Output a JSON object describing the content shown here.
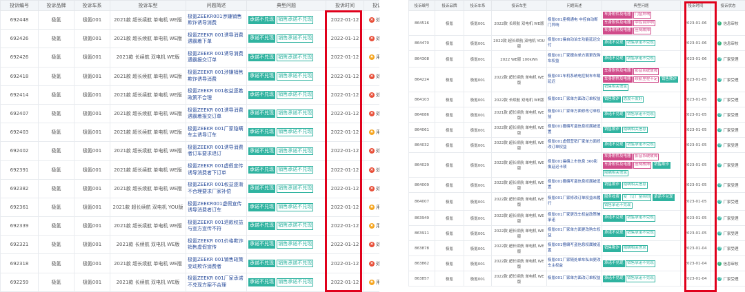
{
  "left": {
    "headers": [
      "投诉编号",
      "投诉品牌",
      "投诉车系",
      "投诉车型",
      "问题简述",
      "典型问题",
      "投诉时间",
      "投诉状态"
    ],
    "rows": [
      {
        "id": "692448",
        "brand": "极氪",
        "series": "极氪001",
        "model": "2021款 超长续航 单电机 WE版",
        "desc": "极氪ZEEKR001涉嫌销售欺诈诱导消费",
        "tags": [
          {
            "t": "承诺不兑现",
            "s": "solid"
          },
          {
            "t": "销售承诺不兑现",
            "s": "outline"
          }
        ],
        "date": "2022-01-12",
        "status": "处理投诉",
        "icon": "red"
      },
      {
        "id": "692426",
        "brand": "极氪",
        "series": "极氪001",
        "model": "2021款 超长续航 单电机 WE版",
        "desc": "极氪ZEEKR 001诱导消费遇霸着下单",
        "tags": [
          {
            "t": "承诺不兑现",
            "s": "solid"
          },
          {
            "t": "销售承诺不兑现",
            "s": "outline"
          }
        ],
        "date": "2022-01-12",
        "status": "处理投诉",
        "icon": "red"
      },
      {
        "id": "692426",
        "brand": "极氪",
        "series": "极氪001",
        "model": "2021款 长续航 双电机 WE版",
        "desc": "极氪ZEEKR 001诱导消费遇霸报交订单",
        "tags": [
          {
            "t": "承诺不兑现",
            "s": "solid"
          },
          {
            "t": "销售承诺不兑现",
            "s": "outline"
          }
        ],
        "date": "2022-01-12",
        "status": "用户评分",
        "icon": "orange"
      },
      {
        "id": "692418",
        "brand": "极氪",
        "series": "极氪001",
        "model": "2021款 超长续航 单电机 WE版",
        "desc": "极氪ZEEKR 001涉嫌销售欺诈诱导消费",
        "tags": [
          {
            "t": "承诺不兑现",
            "s": "solid"
          },
          {
            "t": "销售承诺不兑现",
            "s": "outline"
          }
        ],
        "date": "2022-01-12",
        "status": "处理投诉",
        "icon": "red"
      },
      {
        "id": "692414",
        "brand": "极氪",
        "series": "极氪001",
        "model": "2021款 超长续航 单电机 WE版",
        "desc": "极氪ZEEKR 001权益逐着政策不合理",
        "tags": [
          {
            "t": "承诺不兑现",
            "s": "solid"
          },
          {
            "t": "销售承诺不兑现",
            "s": "outline"
          }
        ],
        "date": "2022-01-12",
        "status": "处理投诉",
        "icon": "red"
      },
      {
        "id": "692407",
        "brand": "极氪",
        "series": "极氪001",
        "model": "2021款 超长续航 单电机 WE版",
        "desc": "极氪ZEEKR 001诱导消费遇霸着报交订单",
        "tags": [
          {
            "t": "承诺不兑现",
            "s": "solid"
          },
          {
            "t": "销售承诺不兑现",
            "s": "outline"
          }
        ],
        "date": "2022-01-12",
        "status": "处理投诉",
        "icon": "red"
      },
      {
        "id": "692403",
        "brand": "极氪",
        "series": "极氪001",
        "model": "2021款 超长续航 单电机 WE版",
        "desc": "极氪ZEEKR 001厂家隐瞒车主诱导订车",
        "tags": [
          {
            "t": "承诺不兑现",
            "s": "solid"
          },
          {
            "t": "销售承诺不兑现",
            "s": "outline"
          }
        ],
        "date": "2022-01-12",
        "status": "用户评分",
        "icon": "orange"
      },
      {
        "id": "692402",
        "brand": "极氪",
        "series": "极氪001",
        "model": "2021款 超长续航 单电机 WE版",
        "desc": "极氪ZEEKR 001诱导消费者订车要求退订",
        "tags": [
          {
            "t": "承诺不兑现",
            "s": "solid"
          },
          {
            "t": "销售承诺不兑现",
            "s": "outline"
          }
        ],
        "date": "2022-01-12",
        "status": "处理投诉",
        "icon": "red"
      },
      {
        "id": "692391",
        "brand": "极氪",
        "series": "极氪001",
        "model": "2021款 超长续航 单电机 WE版",
        "desc": "极氪ZEEKR 001虚假宣传诱导消费者下订单",
        "tags": [
          {
            "t": "承诺不兑现",
            "s": "solid"
          },
          {
            "t": "销售承诺不兑现",
            "s": "outline"
          }
        ],
        "date": "2022-01-12",
        "status": "处理投诉",
        "icon": "red"
      },
      {
        "id": "692382",
        "brand": "极氪",
        "series": "极氪001",
        "model": "2021款 超长续航 单电机 WE版",
        "desc": "极氪ZEEKR 001权益逐渐不合理要求厂家补偿",
        "tags": [
          {
            "t": "承诺不兑现",
            "s": "solid"
          },
          {
            "t": "销售承诺不兑现",
            "s": "outline"
          }
        ],
        "date": "2022-01-12",
        "status": "处理投诉",
        "icon": "red"
      },
      {
        "id": "692361",
        "brand": "极氪",
        "series": "极氪001",
        "model": "2021款 超长续航 双电机 YOU版",
        "desc": "极氪ZEEKR001虚假宣传诱导消费者订车",
        "tags": [
          {
            "t": "承诺不兑现",
            "s": "solid"
          },
          {
            "t": "销售承诺不兑现",
            "s": "outline"
          }
        ],
        "date": "2022-01-12",
        "status": "用户评分",
        "icon": "orange"
      },
      {
        "id": "692339",
        "brand": "极氪",
        "series": "极氪001",
        "model": "2021款 超长续航 单电机 WE版",
        "desc": "极氪ZEEKR 001退款权益与宣方宣传不符",
        "tags": [
          {
            "t": "承诺不兑现",
            "s": "solid"
          },
          {
            "t": "销售承诺不兑现",
            "s": "outline"
          }
        ],
        "date": "2022-01-12",
        "status": "用户评分",
        "icon": "orange"
      },
      {
        "id": "692321",
        "brand": "极氪",
        "series": "极氪001",
        "model": "2021款 长续航 双电机 WE版",
        "desc": "极氪ZEEKR 001价格欺诈销售虚假宣传",
        "tags": [
          {
            "t": "承诺不兑现",
            "s": "solid"
          },
          {
            "t": "销售承诺不兑现",
            "s": "outline"
          }
        ],
        "date": "2022-01-12",
        "status": "处理投诉",
        "icon": "red"
      },
      {
        "id": "692318",
        "brand": "极氪",
        "series": "极氪001",
        "model": "2021款 超长续航 单电机 WE版",
        "desc": "极氪ZEEKR 001销售政策变动欺诈消费者",
        "tags": [
          {
            "t": "承诺不兑现",
            "s": "solid"
          },
          {
            "t": "销售承诺不兑现",
            "s": "outline"
          }
        ],
        "date": "2022-01-12",
        "status": "处理投诉",
        "icon": "red"
      },
      {
        "id": "692259",
        "brand": "极氪",
        "series": "极氪001",
        "model": "2021款 长续航 双电机 WE版",
        "desc": "极氪ZEEKR 001厂家承诺不兑现方案不合理",
        "tags": [
          {
            "t": "承诺不兑现",
            "s": "solid"
          },
          {
            "t": "销售承诺不兑现",
            "s": "outline"
          }
        ],
        "date": "2022-01-12",
        "status": "用户评分",
        "icon": "orange"
      }
    ]
  },
  "right": {
    "headers": [
      "投诉编号",
      "投诉品牌",
      "投诉车系",
      "投诉车型",
      "问题简述",
      "典型问题",
      "投诉时间",
      "投诉状态"
    ],
    "rows": [
      {
        "id": "864516",
        "brand": "极氪",
        "series": "极氪001",
        "model": "2022款 长续航 双电机 WE版",
        "desc": "极氪001座椅通电 中控自动断门异响",
        "tags": [
          {
            "t": "车身附件及电器",
            "s": "pinkfill"
          },
          {
            "t": "门窗异响",
            "s": "pink"
          },
          {
            "t": "车身附件及电器",
            "s": "pinkfill"
          },
          {
            "t": "中控台异响",
            "s": "pink"
          },
          {
            "t": "车身附件及电器",
            "s": "pinkfill"
          },
          {
            "t": "座椅故障",
            "s": "pink"
          }
        ],
        "date": "2023-01-06",
        "status": "信息审核",
        "icon": "green",
        "rh": 34
      },
      {
        "id": "864470",
        "brand": "极氪",
        "series": "极氪001",
        "model": "2022款 超长续航 双电机 YOU版",
        "desc": "极氪001操自动泊车功能延迟交付",
        "tags": [
          {
            "t": "承诺不兑现",
            "s": "solid"
          },
          {
            "t": "销售承诺不兑现",
            "s": "outline"
          }
        ],
        "date": "2023-01-06",
        "status": "信息审核",
        "icon": "green",
        "rh": 22
      },
      {
        "id": "864308",
        "brand": "极氪",
        "series": "极氪001",
        "model": "2022 WE版 100kWh",
        "desc": "极氪001厂家擅自单方面更改购车权益",
        "tags": [
          {
            "t": "承诺不兑现",
            "s": "solid"
          },
          {
            "t": "销售承诺不兑现",
            "s": "outline"
          }
        ],
        "date": "2023-01-06",
        "status": "厂家受理",
        "icon": "teal",
        "rh": 24
      },
      {
        "id": "864224",
        "brand": "极氪",
        "series": "极氪001",
        "model": "2022款 超长续航 单电机 WE版",
        "desc": "极氪001车机系统电控制车车载延迟",
        "tags": [
          {
            "t": "车身附件及电器",
            "s": "pinkfill"
          },
          {
            "t": "影音系统故障",
            "s": "pink"
          },
          {
            "t": "车身附件及电器",
            "s": "pinkfill"
          },
          {
            "t": "续航里程不足",
            "s": "pink"
          },
          {
            "t": "销售欺诈",
            "s": "solid"
          },
          {
            "t": "销售相关信息",
            "s": "outline"
          }
        ],
        "date": "2023-01-05",
        "status": "厂家受理",
        "icon": "teal",
        "rh": 36
      },
      {
        "id": "864103",
        "brand": "极氪",
        "series": "极氪001",
        "model": "2022款 长续航 双电机 WE版",
        "desc": "极氪001厂家单方面改订单权益",
        "tags": [
          {
            "t": "销售欺诈",
            "s": "solid"
          },
          {
            "t": "态度不友好",
            "s": "outline"
          }
        ],
        "date": "2023-01-05",
        "status": "厂家受理",
        "icon": "teal",
        "rh": 22
      },
      {
        "id": "864086",
        "brand": "极氪",
        "series": "极氪001",
        "model": "2021款 超长续航 单电机 WE版",
        "desc": "极氪001厂家单方面修改订单权益",
        "tags": [
          {
            "t": "承诺不兑现",
            "s": "solid"
          },
          {
            "t": "销售承诺不兑现",
            "s": "outline"
          }
        ],
        "date": "2023-01-05",
        "status": "厂家受理",
        "icon": "teal",
        "rh": 22
      },
      {
        "id": "864061",
        "brand": "极氪",
        "series": "极氪001",
        "model": "2022款 超长续航 单电机 WE版",
        "desc": "极氪001擅编写盗信息权属被迫置",
        "tags": [
          {
            "t": "销售欺诈",
            "s": "solid"
          },
          {
            "t": "隐瞒相关信息",
            "s": "outline"
          }
        ],
        "date": "2023-01-05",
        "status": "厂家受理",
        "icon": "teal",
        "rh": 22
      },
      {
        "id": "864032",
        "brand": "极氪",
        "series": "极氪001",
        "model": "2022款 超长续航 单电机 WE版",
        "desc": "极氪001虚假营销厂家单方面修改订单权益",
        "tags": [
          {
            "t": "承诺不兑现",
            "s": "solid"
          },
          {
            "t": "销售承诺不兑现",
            "s": "outline"
          }
        ],
        "date": "2023-01-05",
        "status": "厂家受理",
        "icon": "teal",
        "rh": 22
      },
      {
        "id": "864029",
        "brand": "极氪",
        "series": "极氪001",
        "model": "2022款 超长续航 单电机 WE版",
        "desc": "极氪001操编上市信息 360影像延迟卡顿",
        "tags": [
          {
            "t": "车身附件及电器",
            "s": "pinkfill"
          },
          {
            "t": "影音系统故障",
            "s": "pink"
          },
          {
            "t": "车身附件及电器",
            "s": "pinkfill"
          },
          {
            "t": "座椅故障",
            "s": "pink"
          },
          {
            "t": "销售欺诈",
            "s": "solid"
          },
          {
            "t": "隐瞒相关信息",
            "s": "outline"
          }
        ],
        "date": "2023-01-05",
        "status": "厂家受理",
        "icon": "teal",
        "rh": 36
      },
      {
        "id": "864009",
        "brand": "极氪",
        "series": "极氪001",
        "model": "2022款 超长续航 单电机 WE版",
        "desc": "极氪001擅编写盗信息权属被迫置",
        "tags": [
          {
            "t": "销售欺诈",
            "s": "solid"
          },
          {
            "t": "隐瞒相关信息",
            "s": "outline"
          }
        ],
        "date": "2023-01-05",
        "status": "厂家受理",
        "icon": "teal",
        "rh": 22
      },
      {
        "id": "864007",
        "brand": "极氪",
        "series": "极氪001",
        "model": "2022款 超长续航 单电机 WE版",
        "desc": "极氪001厂家修改订单权益未履行",
        "tags": [
          {
            "t": "服务收费",
            "s": "solid"
          },
          {
            "t": "变（订）金纠纷",
            "s": "outline"
          },
          {
            "t": "承诺不兑现",
            "s": "solid"
          },
          {
            "t": "销售承诺不兑现",
            "s": "outline"
          }
        ],
        "date": "2023-01-05",
        "status": "厂家受理",
        "icon": "teal",
        "rh": 26
      },
      {
        "id": "863949",
        "brand": "极氪",
        "series": "极氪001",
        "model": "2022款 超长续航 单电机 WE版",
        "desc": "极氪001厂家更改车权益政策兼承诺",
        "tags": [
          {
            "t": "承诺不兑现",
            "s": "solid"
          },
          {
            "t": "销售承诺不兑现",
            "s": "outline"
          }
        ],
        "date": "2023-01-05",
        "status": "厂家受理",
        "icon": "teal",
        "rh": 22
      },
      {
        "id": "863911",
        "brand": "极氪",
        "series": "极氪001",
        "model": "2022款 超长续航 单电机 WE版",
        "desc": "极氪001厂家单方面更改购车权益",
        "tags": [
          {
            "t": "承诺不兑现",
            "s": "solid"
          },
          {
            "t": "销售承诺不兑现",
            "s": "outline"
          }
        ],
        "date": "2023-01-05",
        "status": "厂家受理",
        "icon": "teal",
        "rh": 22
      },
      {
        "id": "863878",
        "brand": "极氪",
        "series": "极氪001",
        "model": "2022款 超长续航 单电机 WE版",
        "desc": "极氪001擅编写盗信息权属被迫置",
        "tags": [
          {
            "t": "销售欺诈",
            "s": "solid"
          },
          {
            "t": "隐瞒相关信息",
            "s": "outline"
          }
        ],
        "date": "2023-01-04",
        "status": "厂家受理",
        "icon": "teal",
        "rh": 22
      },
      {
        "id": "863862",
        "brand": "极氪",
        "series": "极氪001",
        "model": "2022款 超长续航 单电机 WE版",
        "desc": "极氪001厂家随处单车私自更改车主权益",
        "tags": [
          {
            "t": "承诺不兑现",
            "s": "solid"
          },
          {
            "t": "销售承诺不兑现",
            "s": "outline"
          }
        ],
        "date": "2023-01-04",
        "status": "信息审核",
        "icon": "green",
        "rh": 22
      },
      {
        "id": "863857",
        "brand": "极氪",
        "series": "极氪001",
        "model": "2022款 超长续航 单电机 WE版",
        "desc": "极氪001厂家单方面改订单权益",
        "tags": [
          {
            "t": "承诺不兑现",
            "s": "solid"
          },
          {
            "t": "销售承诺不兑现",
            "s": "outline"
          }
        ],
        "date": "2023-01-04",
        "status": "厂家受理",
        "icon": "teal",
        "rh": 22
      }
    ]
  },
  "icons": {
    "red": "x-circle-icon",
    "orange": "star-circle-icon",
    "green": "check-circle-icon",
    "teal": "clock-circle-icon"
  },
  "colors": {
    "highlight": "#e0001b",
    "tag": "#2fb3a0",
    "tag_pink": "#d04b8a",
    "link": "#2a4d9b"
  }
}
